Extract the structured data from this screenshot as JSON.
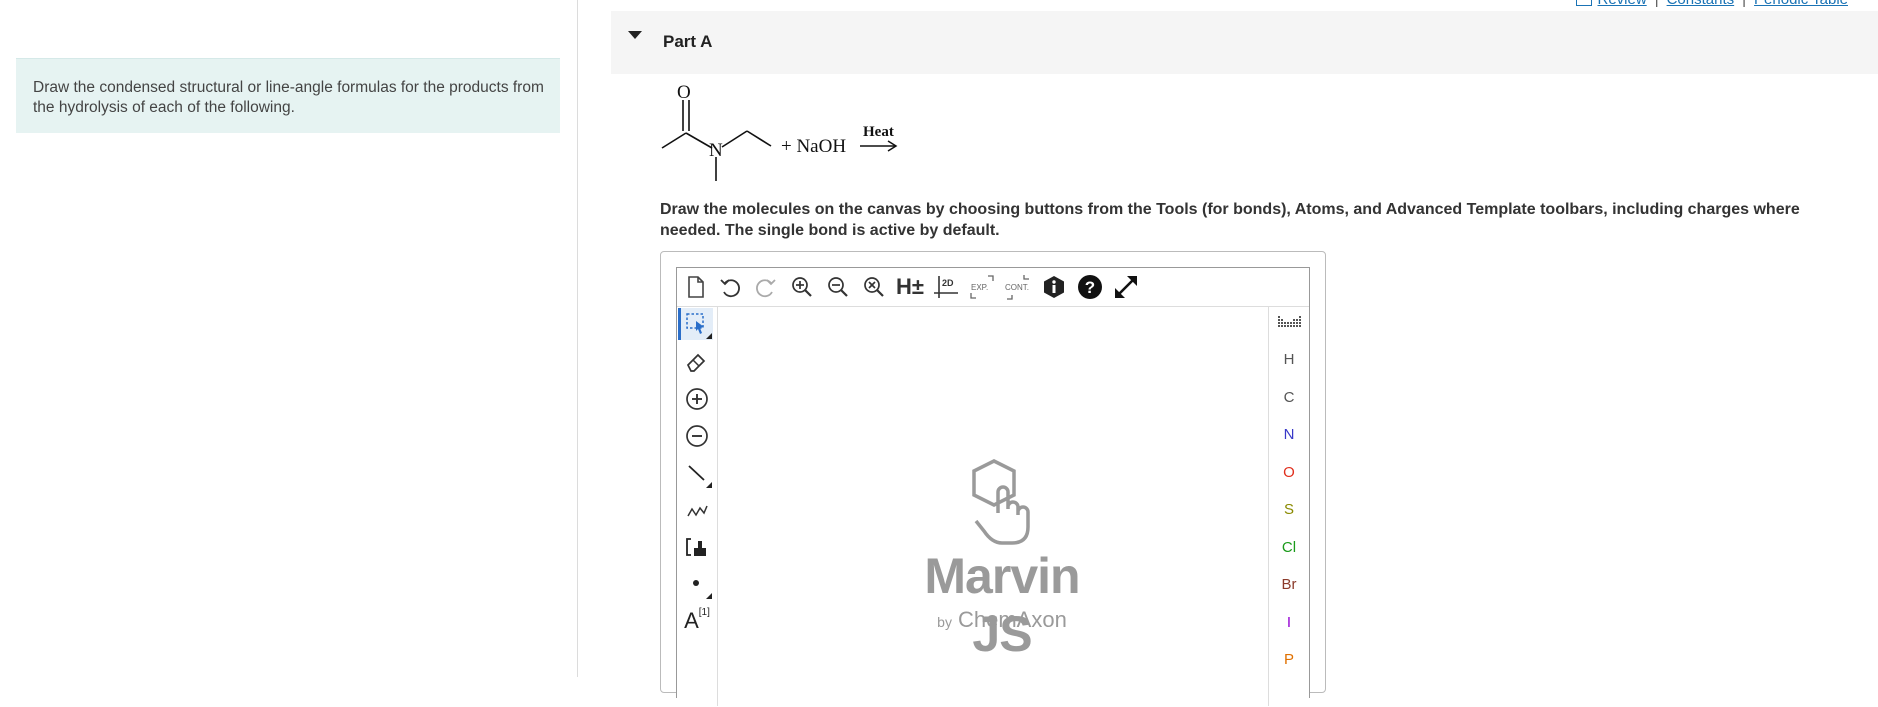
{
  "left_panel": {
    "text": "Draw the condensed structural or line-angle formulas for the products from the hydrolysis of each of the following."
  },
  "top_links": {
    "review": "Review",
    "constants": "Constants",
    "periodic_table": "Periodic Table",
    "separator": "|"
  },
  "part": {
    "title": "Part A"
  },
  "reaction": {
    "oxygen": "O",
    "nitrogen": "N",
    "plus_reagent": "+ NaOH",
    "condition": "Heat"
  },
  "instructions": "Draw the molecules on the canvas by choosing buttons from the Tools (for bonds), Atoms, and Advanced Template toolbars, including charges where needed. The single bond is active by default.",
  "marvin": {
    "toolbar": {
      "hydrogens": "H±",
      "two_d": "2D",
      "expand": "EXP.",
      "contract": "CONT.",
      "help": "?",
      "info": "i"
    },
    "atoms": [
      {
        "symbol": "H",
        "color": "#555555"
      },
      {
        "symbol": "C",
        "color": "#555555"
      },
      {
        "symbol": "N",
        "color": "#3838c8"
      },
      {
        "symbol": "O",
        "color": "#e0301e"
      },
      {
        "symbol": "S",
        "color": "#8a8a00"
      },
      {
        "symbol": "Cl",
        "color": "#1a9a1a"
      },
      {
        "symbol": "Br",
        "color": "#8b3a2a"
      },
      {
        "symbol": "I",
        "color": "#9400d3"
      },
      {
        "symbol": "P",
        "color": "#e07000"
      }
    ],
    "text_tool": "A",
    "text_tool_sup": "[1]",
    "logo_name": "Marvin JS",
    "logo_by": "by",
    "logo_company": "ChemAxon"
  }
}
